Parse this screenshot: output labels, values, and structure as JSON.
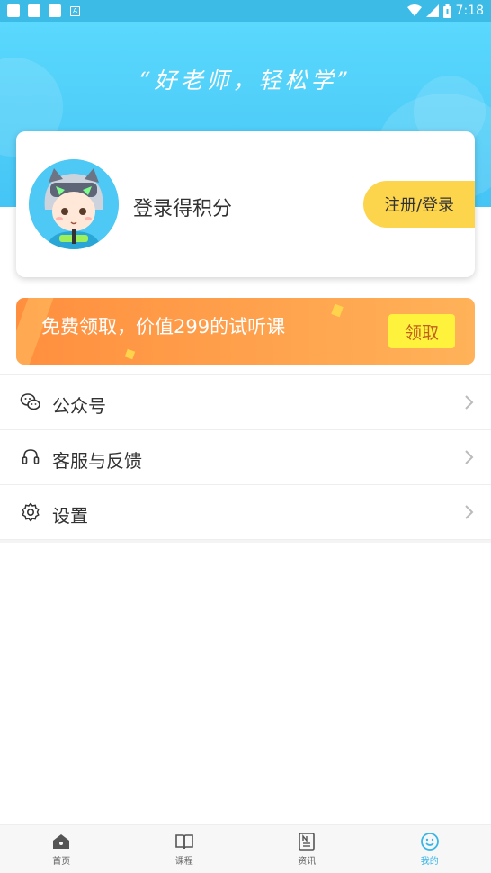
{
  "status_bar": {
    "time": "7:18"
  },
  "header": {
    "slogan": "“好老师，轻松学”"
  },
  "profile": {
    "login_prompt": "登录得积分",
    "login_button": "注册/登录"
  },
  "promo": {
    "text": "免费领取，价值299的试听课",
    "button": "领取"
  },
  "menu": {
    "items": [
      {
        "label": "公众号",
        "icon": "wechat-icon"
      },
      {
        "label": "客服与反馈",
        "icon": "headset-icon"
      },
      {
        "label": "设置",
        "icon": "gear-icon"
      }
    ]
  },
  "tabs": [
    {
      "label": "首页",
      "icon": "home-icon"
    },
    {
      "label": "课程",
      "icon": "book-icon"
    },
    {
      "label": "资讯",
      "icon": "news-icon"
    },
    {
      "label": "我的",
      "icon": "smiley-icon",
      "active": true
    }
  ],
  "colors": {
    "accent": "#38b6e6",
    "login_button": "#fcd54c",
    "promo_start": "#ff8f3f",
    "promo_end": "#ffb259",
    "promo_button": "#fff23d"
  }
}
